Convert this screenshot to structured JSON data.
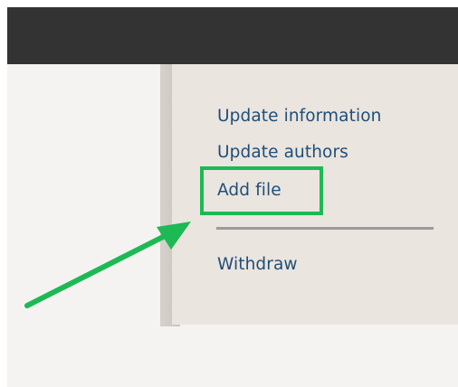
{
  "menu": {
    "update_information": "Update information",
    "update_authors": "Update authors",
    "add_file": "Add file",
    "withdraw": "Withdraw"
  },
  "annotation": {
    "highlight_color": "#1db954",
    "arrow_color": "#1db954",
    "highlighted_item": "Add file"
  },
  "colors": {
    "topbar": "#333333",
    "panel_bg": "#eae5df",
    "link": "#1f4e79",
    "page_bg": "#f4f3f1"
  }
}
